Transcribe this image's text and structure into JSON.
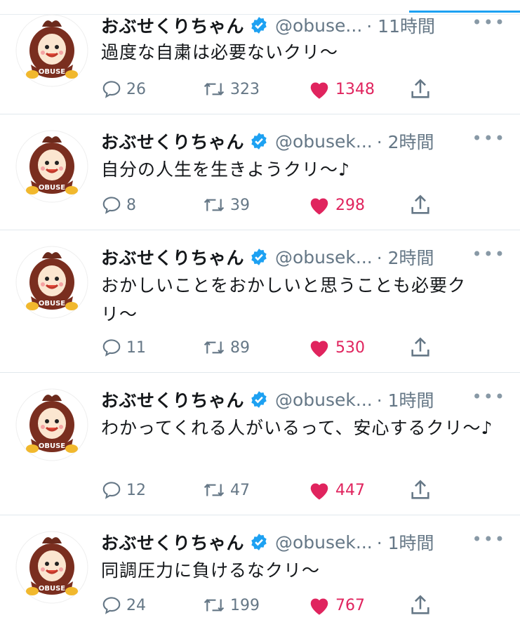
{
  "colors": {
    "accent": "#1da1f2",
    "like": "#e0245e",
    "secondary_text": "#657786",
    "verified": "#1da1f2"
  },
  "tweets": [
    {
      "name": "おぶせくりちゃん",
      "handle": "@obuse...",
      "time": "· 11時間",
      "text": "過度な自粛は必要ないクリ〜",
      "replies": "26",
      "retweets": "323",
      "likes": "1348",
      "liked": true
    },
    {
      "name": "おぶせくりちゃん",
      "handle": "@obusek...",
      "time": "· 2時間",
      "text": "自分の人生を生きようクリ〜♪",
      "replies": "8",
      "retweets": "39",
      "likes": "298",
      "liked": true
    },
    {
      "name": "おぶせくりちゃん",
      "handle": "@obusek...",
      "time": "· 2時間",
      "text": "おかしいことをおかしいと思うことも必要クリ〜",
      "replies": "11",
      "retweets": "89",
      "likes": "530",
      "liked": true
    },
    {
      "name": "おぶせくりちゃん",
      "handle": "@obusek...",
      "time": "· 1時間",
      "text": "わかってくれる人がいるって、安心するクリ〜♪",
      "replies": "12",
      "retweets": "47",
      "likes": "447",
      "liked": true
    },
    {
      "name": "おぶせくりちゃん",
      "handle": "@obusek...",
      "time": "· 1時間",
      "text": "同調圧力に負けるなクリ〜",
      "replies": "24",
      "retweets": "199",
      "likes": "767",
      "liked": true
    }
  ],
  "avatar_logo_text": "OBUSE",
  "icons": {
    "reply": "reply-icon",
    "retweet": "retweet-icon",
    "like": "heart-icon",
    "share": "share-icon",
    "verified": "verified-badge-icon",
    "more": "more-options-icon"
  }
}
